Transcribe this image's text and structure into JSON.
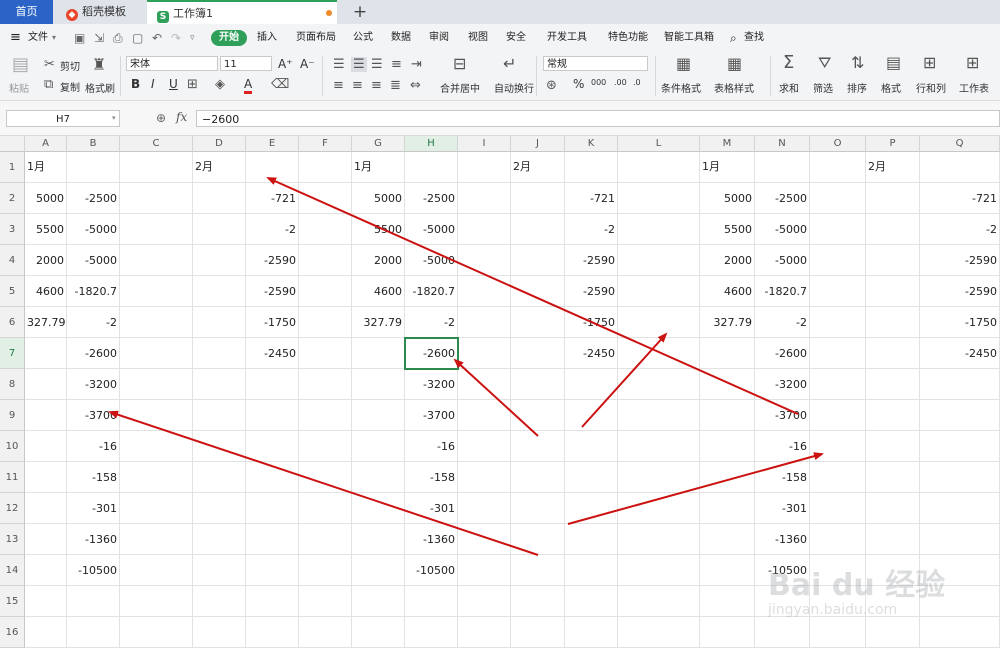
{
  "tabs": {
    "home": "首页",
    "template": "稻壳模板",
    "workbook": "工作簿1",
    "add": "+"
  },
  "menu": [
    "文件",
    "开始",
    "插入",
    "页面布局",
    "公式",
    "数据",
    "审阅",
    "视图",
    "安全",
    "开发工具",
    "特色功能",
    "智能工具箱",
    "查找"
  ],
  "ribbon": {
    "cut": "剪切",
    "copy": "复制",
    "paste": "粘贴",
    "format_painter": "格式刷",
    "font_name": "宋体",
    "font_size": "11",
    "bold": "B",
    "italic": "I",
    "underline": "U",
    "merge_center": "合并居中",
    "wrap": "自动换行",
    "number_format": "常规",
    "percent": "%",
    "cond_format": "条件格式",
    "table_style": "表格样式",
    "sum": "求和",
    "filter": "筛选",
    "sort": "排序",
    "format": "格式",
    "row_col": "行和列",
    "worksheet": "工作表"
  },
  "formula_bar": {
    "cell_ref": "H7",
    "fx": "fx",
    "value": "−2600"
  },
  "columns": [
    "A",
    "B",
    "C",
    "D",
    "E",
    "F",
    "G",
    "H",
    "I",
    "J",
    "K",
    "L",
    "M",
    "N",
    "O",
    "P",
    "Q"
  ],
  "rows": [
    "1",
    "2",
    "3",
    "4",
    "5",
    "6",
    "7",
    "8",
    "9",
    "10",
    "11",
    "12",
    "13",
    "14",
    "15",
    "16"
  ],
  "selected": {
    "column": "H",
    "row": "7"
  },
  "cells": [
    {
      "col": "A",
      "row": 1,
      "v": "1月",
      "t": "txt"
    },
    {
      "col": "D",
      "row": 1,
      "v": "2月",
      "t": "txt"
    },
    {
      "col": "G",
      "row": 1,
      "v": "1月",
      "t": "txt"
    },
    {
      "col": "J",
      "row": 1,
      "v": "2月",
      "t": "txt"
    },
    {
      "col": "M",
      "row": 1,
      "v": "1月",
      "t": "txt"
    },
    {
      "col": "P",
      "row": 1,
      "v": "2月",
      "t": "txt"
    },
    {
      "col": "A",
      "row": 2,
      "v": "5000"
    },
    {
      "col": "B",
      "row": 2,
      "v": "-2500"
    },
    {
      "col": "E",
      "row": 2,
      "v": "-721"
    },
    {
      "col": "G",
      "row": 2,
      "v": "5000"
    },
    {
      "col": "H",
      "row": 2,
      "v": "-2500"
    },
    {
      "col": "K",
      "row": 2,
      "v": "-721"
    },
    {
      "col": "M",
      "row": 2,
      "v": "5000"
    },
    {
      "col": "N",
      "row": 2,
      "v": "-2500"
    },
    {
      "col": "Q",
      "row": 2,
      "v": "-721"
    },
    {
      "col": "A",
      "row": 3,
      "v": "5500"
    },
    {
      "col": "B",
      "row": 3,
      "v": "-5000"
    },
    {
      "col": "E",
      "row": 3,
      "v": "-2"
    },
    {
      "col": "G",
      "row": 3,
      "v": "5500"
    },
    {
      "col": "H",
      "row": 3,
      "v": "-5000"
    },
    {
      "col": "K",
      "row": 3,
      "v": "-2"
    },
    {
      "col": "M",
      "row": 3,
      "v": "5500"
    },
    {
      "col": "N",
      "row": 3,
      "v": "-5000"
    },
    {
      "col": "Q",
      "row": 3,
      "v": "-2"
    },
    {
      "col": "A",
      "row": 4,
      "v": "2000"
    },
    {
      "col": "B",
      "row": 4,
      "v": "-5000"
    },
    {
      "col": "E",
      "row": 4,
      "v": "-2590"
    },
    {
      "col": "G",
      "row": 4,
      "v": "2000"
    },
    {
      "col": "H",
      "row": 4,
      "v": "-5000"
    },
    {
      "col": "K",
      "row": 4,
      "v": "-2590"
    },
    {
      "col": "M",
      "row": 4,
      "v": "2000"
    },
    {
      "col": "N",
      "row": 4,
      "v": "-5000"
    },
    {
      "col": "Q",
      "row": 4,
      "v": "-2590"
    },
    {
      "col": "A",
      "row": 5,
      "v": "4600"
    },
    {
      "col": "B",
      "row": 5,
      "v": "-1820.7"
    },
    {
      "col": "E",
      "row": 5,
      "v": "-2590"
    },
    {
      "col": "G",
      "row": 5,
      "v": "4600"
    },
    {
      "col": "H",
      "row": 5,
      "v": "-1820.7"
    },
    {
      "col": "K",
      "row": 5,
      "v": "-2590"
    },
    {
      "col": "M",
      "row": 5,
      "v": "4600"
    },
    {
      "col": "N",
      "row": 5,
      "v": "-1820.7"
    },
    {
      "col": "Q",
      "row": 5,
      "v": "-2590"
    },
    {
      "col": "A",
      "row": 6,
      "v": "327.79"
    },
    {
      "col": "B",
      "row": 6,
      "v": "-2"
    },
    {
      "col": "E",
      "row": 6,
      "v": "-1750"
    },
    {
      "col": "G",
      "row": 6,
      "v": "327.79"
    },
    {
      "col": "H",
      "row": 6,
      "v": "-2"
    },
    {
      "col": "K",
      "row": 6,
      "v": "-1750"
    },
    {
      "col": "M",
      "row": 6,
      "v": "327.79"
    },
    {
      "col": "N",
      "row": 6,
      "v": "-2"
    },
    {
      "col": "Q",
      "row": 6,
      "v": "-1750"
    },
    {
      "col": "B",
      "row": 7,
      "v": "-2600"
    },
    {
      "col": "E",
      "row": 7,
      "v": "-2450"
    },
    {
      "col": "H",
      "row": 7,
      "v": "-2600"
    },
    {
      "col": "K",
      "row": 7,
      "v": "-2450"
    },
    {
      "col": "N",
      "row": 7,
      "v": "-2600"
    },
    {
      "col": "Q",
      "row": 7,
      "v": "-2450"
    },
    {
      "col": "B",
      "row": 8,
      "v": "-3200"
    },
    {
      "col": "H",
      "row": 8,
      "v": "-3200"
    },
    {
      "col": "N",
      "row": 8,
      "v": "-3200"
    },
    {
      "col": "B",
      "row": 9,
      "v": "-3700"
    },
    {
      "col": "H",
      "row": 9,
      "v": "-3700"
    },
    {
      "col": "N",
      "row": 9,
      "v": "-3700"
    },
    {
      "col": "B",
      "row": 10,
      "v": "-16"
    },
    {
      "col": "H",
      "row": 10,
      "v": "-16"
    },
    {
      "col": "N",
      "row": 10,
      "v": "-16"
    },
    {
      "col": "B",
      "row": 11,
      "v": "-158"
    },
    {
      "col": "H",
      "row": 11,
      "v": "-158"
    },
    {
      "col": "N",
      "row": 11,
      "v": "-158"
    },
    {
      "col": "B",
      "row": 12,
      "v": "-301"
    },
    {
      "col": "H",
      "row": 12,
      "v": "-301"
    },
    {
      "col": "N",
      "row": 12,
      "v": "-301"
    },
    {
      "col": "B",
      "row": 13,
      "v": "-1360"
    },
    {
      "col": "H",
      "row": 13,
      "v": "-1360"
    },
    {
      "col": "N",
      "row": 13,
      "v": "-1360"
    },
    {
      "col": "B",
      "row": 14,
      "v": "-10500"
    },
    {
      "col": "H",
      "row": 14,
      "v": "-10500"
    },
    {
      "col": "N",
      "row": 14,
      "v": "-10500"
    }
  ],
  "annotation_color": "#cc1111",
  "watermark": {
    "brand": "Bai du 经验",
    "url": "jingyan.baidu.com"
  }
}
